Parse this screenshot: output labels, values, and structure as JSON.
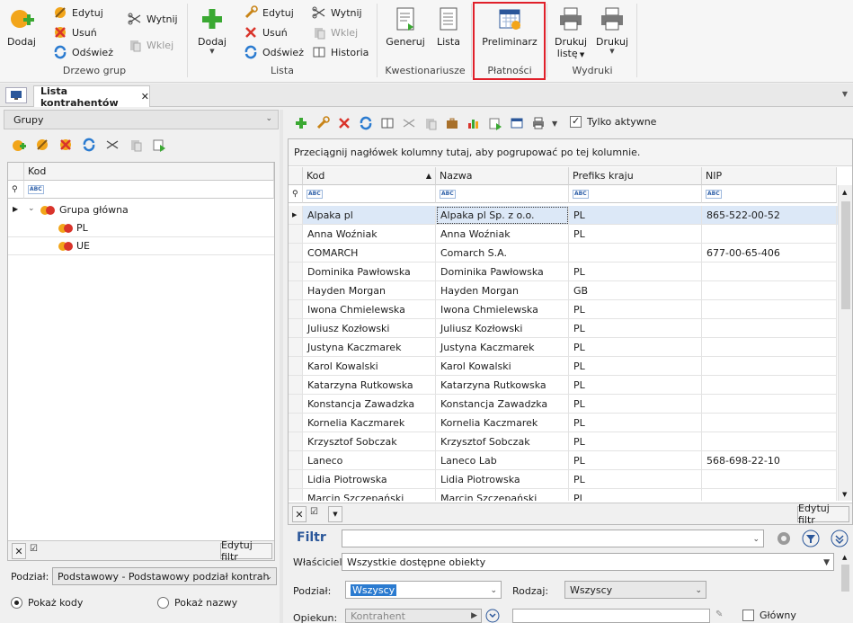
{
  "ribbon": {
    "group1": {
      "label": "Drzewo grup",
      "dodaj": "Dodaj",
      "edytuj": "Edytuj",
      "usun": "Usuń",
      "odswiez": "Odśwież",
      "wytnij": "Wytnij",
      "wklej": "Wklej"
    },
    "group2": {
      "label": "Lista",
      "dodaj": "Dodaj",
      "edytuj": "Edytuj",
      "usun": "Usuń",
      "odswiez": "Odśwież",
      "wytnij": "Wytnij",
      "wklej": "Wklej",
      "historia": "Historia"
    },
    "group3": {
      "label": "Kwestionariusze",
      "generuj": "Generuj",
      "lista": "Lista"
    },
    "group4": {
      "label": "Płatności",
      "preliminarz": "Preliminarz"
    },
    "group5": {
      "label": "Wydruki",
      "drukuj_liste_1": "Drukuj",
      "drukuj_liste_2": "listę",
      "drukuj": "Drukuj"
    }
  },
  "tab": {
    "title": "Lista kontrahentów",
    "close": "✕"
  },
  "groups_panel": {
    "title": "Grupy",
    "column": "Kod",
    "tree": [
      {
        "label": "Grupa główna"
      },
      {
        "label": "PL"
      },
      {
        "label": "UE"
      }
    ],
    "edit_filter": "Edytuj filtr",
    "podzial_label": "Podział:",
    "podzial_value": "Podstawowy - Podstawowy podział kontrah",
    "radio_codes": "Pokaż kody",
    "radio_names": "Pokaż nazwy"
  },
  "list": {
    "only_active": "Tylko aktywne",
    "group_hint": "Przeciągnij nagłówek kolumny tutaj, aby pogrupować po tej kolumnie.",
    "columns": [
      "Kod",
      "Nazwa",
      "Prefiks kraju",
      "NIP"
    ],
    "rows": [
      [
        "Alpaka pl",
        "Alpaka pl Sp. z o.o.",
        "PL",
        "865-522-00-52"
      ],
      [
        "Anna Woźniak",
        "Anna Woźniak",
        "PL",
        ""
      ],
      [
        "COMARCH",
        "Comarch S.A.",
        "",
        "677-00-65-406"
      ],
      [
        "Dominika Pawłowska",
        "Dominika Pawłowska",
        "PL",
        ""
      ],
      [
        "Hayden Morgan",
        "Hayden Morgan",
        "GB",
        ""
      ],
      [
        "Iwona Chmielewska",
        "Iwona Chmielewska",
        "PL",
        ""
      ],
      [
        "Juliusz Kozłowski",
        "Juliusz Kozłowski",
        "PL",
        ""
      ],
      [
        "Justyna Kaczmarek",
        "Justyna Kaczmarek",
        "PL",
        ""
      ],
      [
        "Karol Kowalski",
        "Karol Kowalski",
        "PL",
        ""
      ],
      [
        "Katarzyna Rutkowska",
        "Katarzyna Rutkowska",
        "PL",
        ""
      ],
      [
        "Konstancja Zawadzka",
        "Konstancja Zawadzka",
        "PL",
        ""
      ],
      [
        "Kornelia Kaczmarek",
        "Kornelia Kaczmarek",
        "PL",
        ""
      ],
      [
        "Krzysztof Sobczak",
        "Krzysztof Sobczak",
        "PL",
        ""
      ],
      [
        "Laneco",
        "Laneco Lab",
        "PL",
        "568-698-22-10"
      ],
      [
        "Lidia Piotrowska",
        "Lidia Piotrowska",
        "PL",
        ""
      ],
      [
        "Marcin Szczepański",
        "Marcin Szczepański",
        "PL",
        ""
      ]
    ],
    "edit_filter": "Edytuj filtr"
  },
  "filter": {
    "title": "Filtr",
    "wlasciciel_label": "Właściciel:",
    "wlasciciel_value": "Wszystkie dostępne obiekty",
    "podzial_label": "Podział:",
    "podzial_value": "Wszyscy",
    "rodzaj_label": "Rodzaj:",
    "rodzaj_value": "Wszyscy",
    "opiekun_label": "Opiekun:",
    "opiekun_value": "Kontrahent",
    "glowny_label": "Główny"
  },
  "colors": {
    "accent": "#2b579a",
    "highlight": "#e0202a",
    "selected_row": "#dce8f7",
    "green": "#3aa832",
    "red": "#d9342b"
  }
}
